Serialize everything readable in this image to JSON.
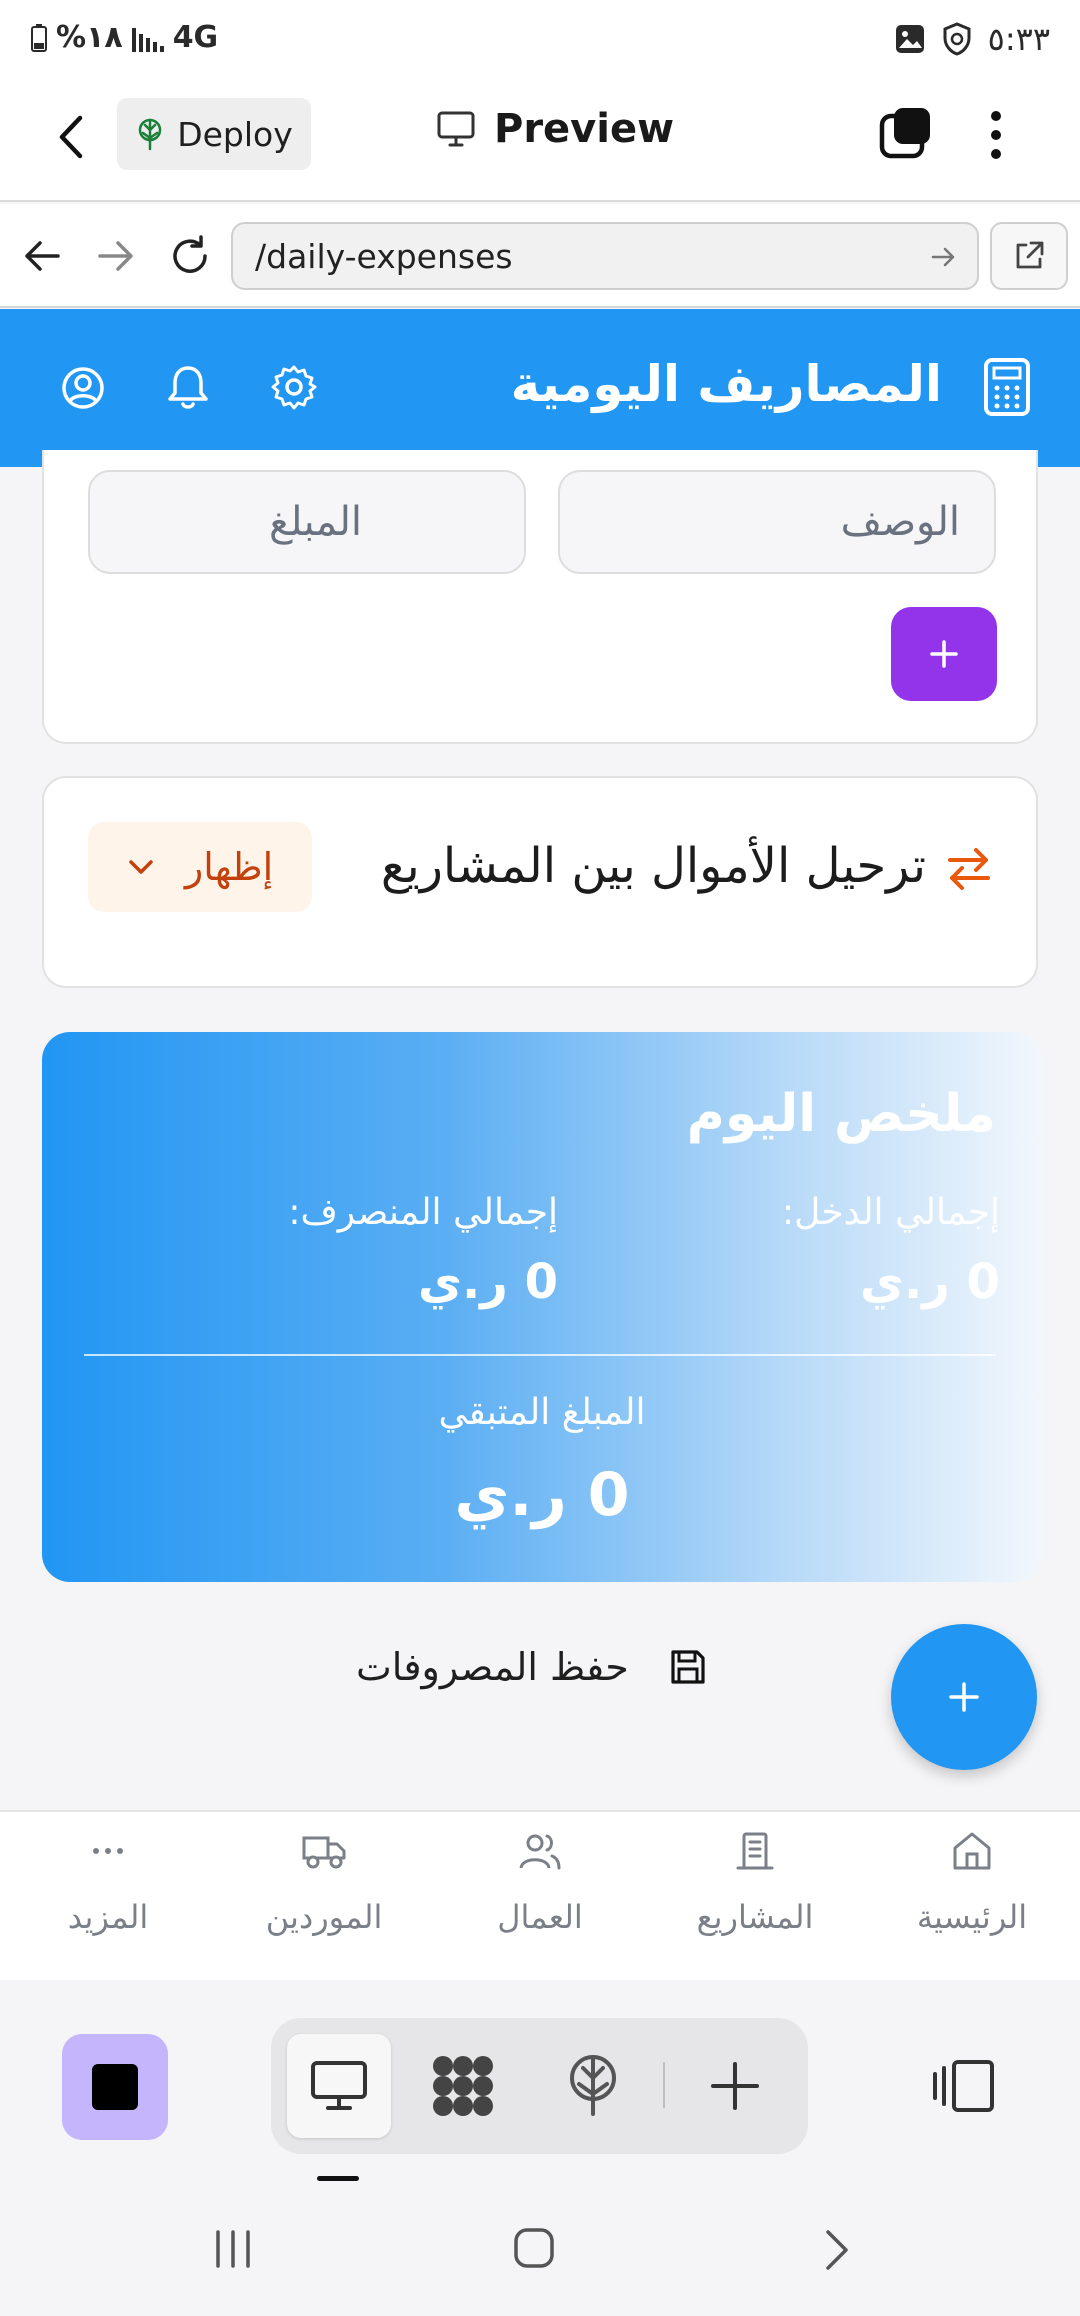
{
  "status_bar": {
    "battery": "%١٨",
    "network": "4G",
    "time": "٥:٣٣"
  },
  "top_bar": {
    "deploy_label": "Deploy",
    "preview_label": "Preview"
  },
  "browser": {
    "url": "/daily-expenses"
  },
  "app_header": {
    "title": "المصاريف اليومية"
  },
  "expense_form": {
    "description_placeholder": "الوصف",
    "amount_placeholder": "المبلغ",
    "add_label": "+"
  },
  "transfer_section": {
    "title": "ترحيل الأموال بين المشاريع",
    "toggle_label": "إظهار"
  },
  "summary": {
    "title": "ملخص اليوم",
    "income_label": "إجمالي الدخل:",
    "income_value": "0 ر.ي",
    "expense_label": "إجمالي المنصرف:",
    "expense_value": "0 ر.ي",
    "remaining_label": "المبلغ المتبقي",
    "remaining_value": "0 ر.ي"
  },
  "actions": {
    "save_label": "حفظ المصروفات",
    "fab_label": "+"
  },
  "bottom_nav": {
    "items": [
      {
        "label": "الرئيسية",
        "icon": "home-icon"
      },
      {
        "label": "المشاريع",
        "icon": "building-icon"
      },
      {
        "label": "العمال",
        "icon": "users-icon"
      },
      {
        "label": "الموردين",
        "icon": "truck-icon"
      },
      {
        "label": "المزيد",
        "icon": "more-icon"
      }
    ]
  },
  "colors": {
    "primary": "#2196f3",
    "purple": "#9333ea",
    "orange": "#c2410c"
  }
}
